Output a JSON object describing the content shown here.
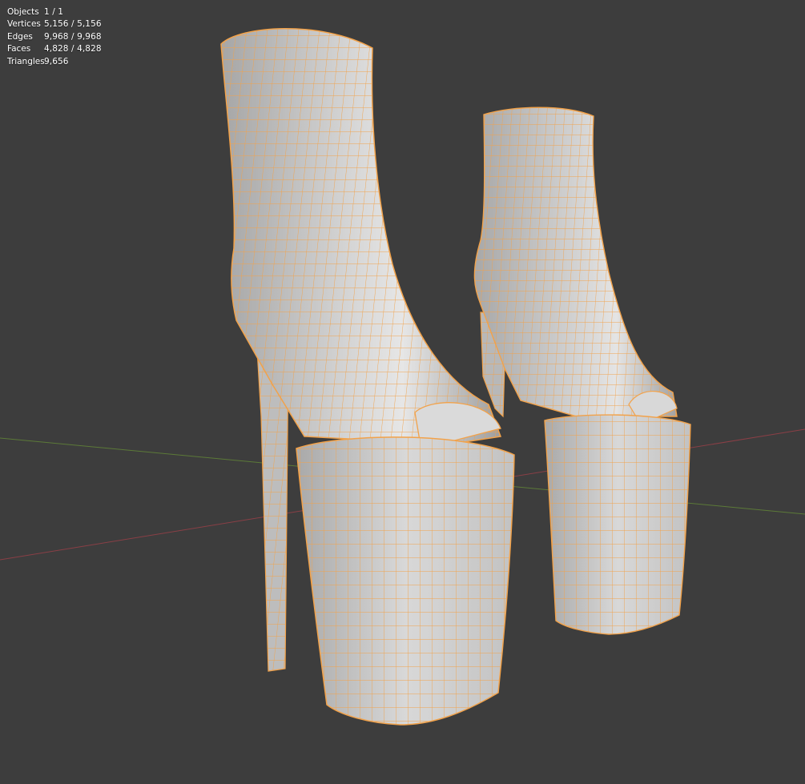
{
  "viewport": {
    "background_color": "#3d3d3d",
    "x_axis_color": "#8a3f46",
    "y_axis_color": "#5c7a38",
    "object": "boots",
    "mesh_fill_color": "#c9c9c9",
    "wireframe_color": "#f2a24a",
    "edit_mode": "wireframe-overlay"
  },
  "stats": [
    {
      "label": "Objects",
      "value": "1 / 1"
    },
    {
      "label": "Vertices",
      "value": "5,156 / 5,156"
    },
    {
      "label": "Edges",
      "value": "9,968 / 9,968"
    },
    {
      "label": "Faces",
      "value": "4,828 / 4,828"
    },
    {
      "label": "Triangles",
      "value": "9,656"
    }
  ]
}
